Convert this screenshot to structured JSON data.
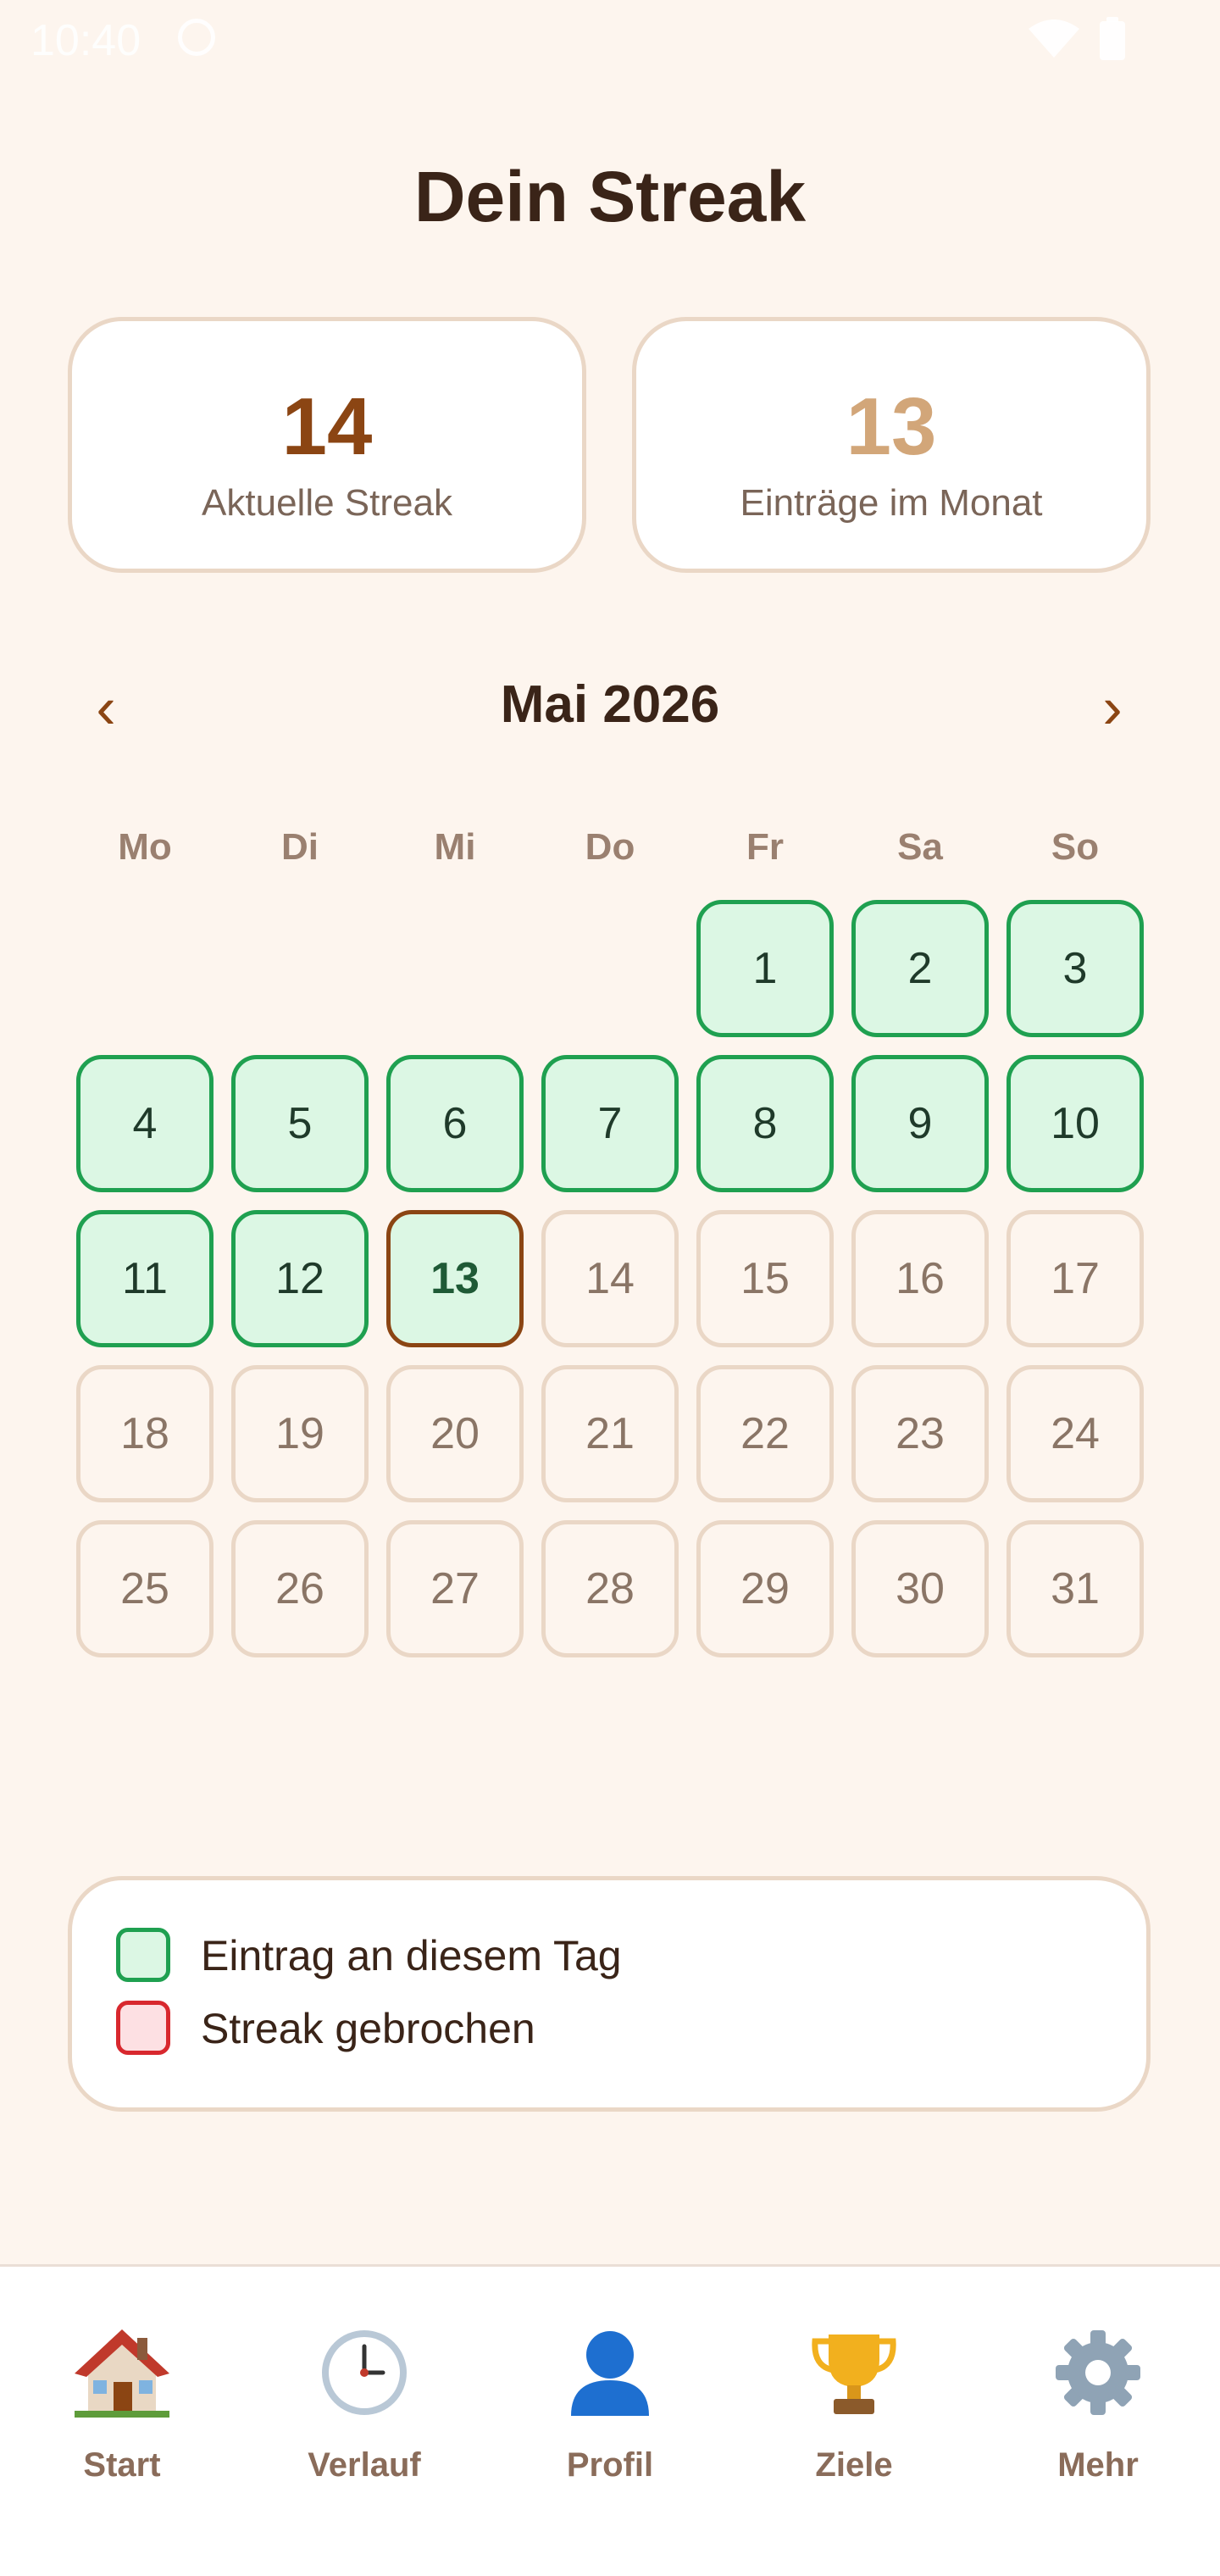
{
  "status_bar": {
    "time": "10:40"
  },
  "title": "Dein Streak",
  "stats": {
    "current_streak": {
      "value": "14",
      "label": "Aktuelle Streak"
    },
    "entries_month": {
      "value": "13",
      "label": "Einträge im Monat"
    }
  },
  "calendar": {
    "month_label": "Mai 2026",
    "prev_symbol": "‹",
    "next_symbol": "›",
    "weekdays": [
      "Mo",
      "Di",
      "Mi",
      "Do",
      "Fr",
      "Sa",
      "So"
    ],
    "first_weekday_index": 4,
    "days_in_month": 31,
    "entry_days": [
      1,
      2,
      3,
      4,
      5,
      6,
      7,
      8,
      9,
      10,
      11,
      12
    ],
    "today": 13
  },
  "legend": {
    "entry": "Eintrag an diesem Tag",
    "broken": "Streak gebrochen"
  },
  "bottom_nav": {
    "items": [
      {
        "label": "Start",
        "icon": "house-icon"
      },
      {
        "label": "Verlauf",
        "icon": "clock-icon"
      },
      {
        "label": "Profil",
        "icon": "user-icon"
      },
      {
        "label": "Ziele",
        "icon": "trophy-icon"
      },
      {
        "label": "Mehr",
        "icon": "gear-icon"
      }
    ]
  },
  "colors": {
    "background": "#FDF5EE",
    "entry_green": "#1FA050",
    "entry_fill": "#DCF7E4",
    "broken_red": "#D8282E",
    "accent_brown": "#8B4513"
  }
}
